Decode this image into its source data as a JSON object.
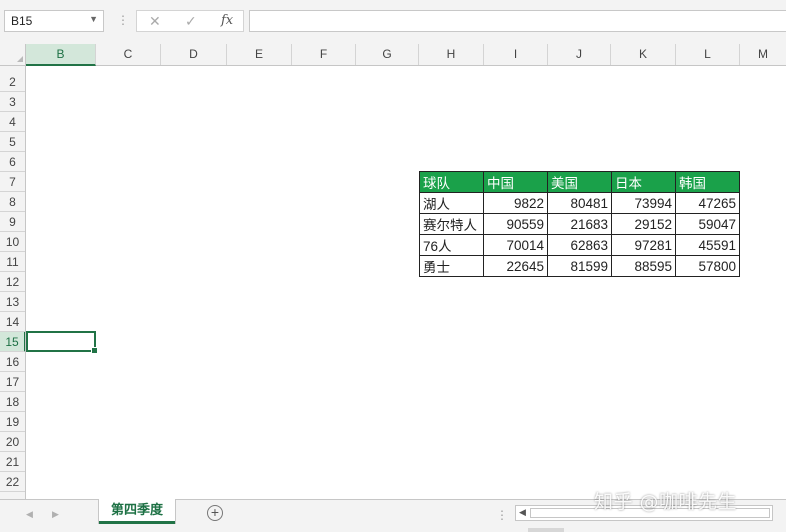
{
  "formula_bar": {
    "name_box": "B15",
    "cancel_symbol": "✕",
    "enter_symbol": "✓",
    "fx_label": "fx",
    "formula": ""
  },
  "columns": [
    "B",
    "C",
    "D",
    "E",
    "F",
    "G",
    "H",
    "I",
    "J",
    "K",
    "L",
    "M"
  ],
  "active_column": "B",
  "rows": [
    "2",
    "3",
    "4",
    "5",
    "6",
    "7",
    "8",
    "9",
    "10",
    "11",
    "12",
    "13",
    "14",
    "15",
    "16",
    "17",
    "18",
    "19",
    "20",
    "21",
    "22"
  ],
  "active_row": "15",
  "table": {
    "header": [
      "球队",
      "中国",
      "美国",
      "日本",
      "韩国"
    ],
    "rows": [
      {
        "team": "湖人",
        "values": [
          "9822",
          "80481",
          "73994",
          "47265"
        ]
      },
      {
        "team": "赛尔特人",
        "values": [
          "90559",
          "21683",
          "29152",
          "59047"
        ]
      },
      {
        "team": "76人",
        "values": [
          "70014",
          "62863",
          "97281",
          "45591"
        ]
      },
      {
        "team": "勇士",
        "values": [
          "22645",
          "81599",
          "88595",
          "57800"
        ]
      }
    ],
    "header_color": "#1aa14a"
  },
  "sheet_tabs": [
    {
      "label": "第四季度",
      "active": true
    }
  ],
  "watermark": "知乎 @咖啡先生",
  "accent_color": "#217346"
}
